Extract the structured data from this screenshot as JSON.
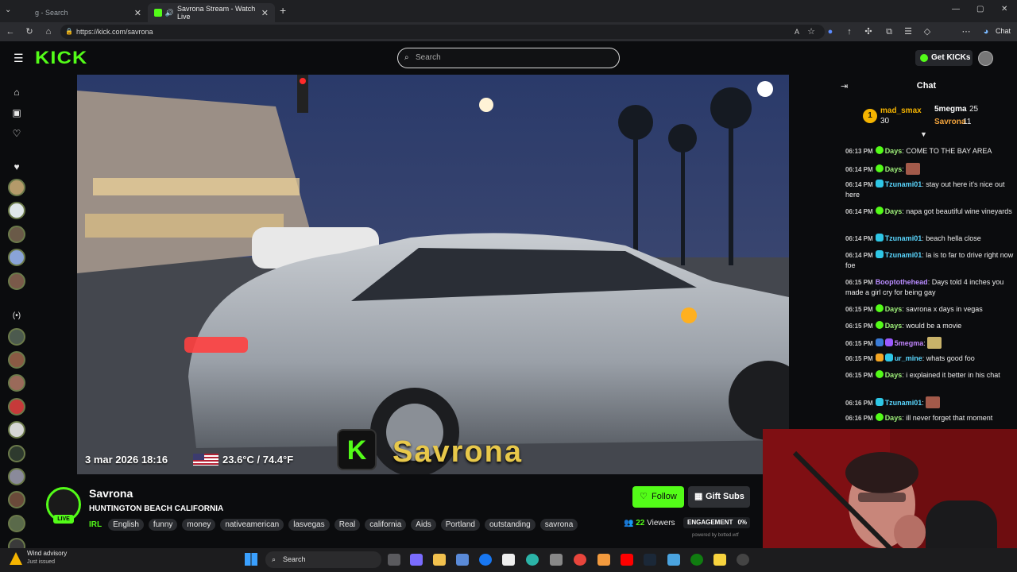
{
  "browser": {
    "tabs": [
      {
        "label": "g - Search",
        "active": false
      },
      {
        "label": "Savrona Stream - Watch Live",
        "active": true
      }
    ],
    "new_tab": "+",
    "url": "https://kick.com/savrona",
    "copilot_label": "Chat"
  },
  "header": {
    "logo": "KICK",
    "search_placeholder": "Search",
    "get_kicks": "Get KICKs"
  },
  "video": {
    "overlay_date": "3 mar 2026 18:16",
    "overlay_temp": "23.6°C / 74.4°F",
    "overlay_name": "Savrona",
    "overlay_logo": "K"
  },
  "channel": {
    "name": "Savrona",
    "live_label": "LIVE",
    "title": "HUNTINGTON BEACH CALIFORNIA",
    "category": "IRL",
    "tags": [
      "English",
      "funny",
      "money",
      "nativeamerican",
      "lasvegas",
      "Real",
      "california",
      "Aids",
      "Portland",
      "outstanding",
      "savrona"
    ],
    "follow": "Follow",
    "gift_subs": "Gift Subs",
    "viewers_count": "22",
    "viewers_label": "Viewers",
    "engagement_label": "ENGAGEMENT",
    "engagement_value": "0%",
    "powered_by": "powered by botted.wtf"
  },
  "chat": {
    "title": "Chat",
    "leaderboard": [
      {
        "rank": "1",
        "name": "mad_smax",
        "count": "30"
      },
      {
        "name": "5megma",
        "count": "25"
      },
      {
        "name": "Savrona",
        "count": "11"
      }
    ],
    "messages": [
      {
        "time": "06:13 PM",
        "user": "Days",
        "text": "COME TO THE BAY AREA"
      },
      {
        "time": "06:14 PM",
        "user": "Days",
        "text": ""
      },
      {
        "time": "06:14 PM",
        "user": "Tzunami01",
        "text": "stay out here it's nice out here"
      },
      {
        "time": "06:14 PM",
        "user": "Days",
        "text": "napa got beautiful wine vineyards"
      },
      {
        "time": "06:14 PM",
        "user": "Tzunami01",
        "text": "beach hella close"
      },
      {
        "time": "06:14 PM",
        "user": "Tzunami01",
        "text": "la is to far to drive right now foe"
      },
      {
        "time": "06:15 PM",
        "user": "Booptothehead",
        "text": "Days told 4 inches you made a girl cry for being gay"
      },
      {
        "time": "06:15 PM",
        "user": "Days",
        "text": "savrona x days in vegas"
      },
      {
        "time": "06:15 PM",
        "user": "Days",
        "text": "would be a movie"
      },
      {
        "time": "06:15 PM",
        "user": "5megma",
        "text": ""
      },
      {
        "time": "06:15 PM",
        "user": "ur_mine",
        "text": "whats good foo"
      },
      {
        "time": "06:15 PM",
        "user": "Days",
        "text": "i explained it better in his chat"
      },
      {
        "time": "06:16 PM",
        "user": "Tzunami01",
        "text": ""
      },
      {
        "time": "06:16 PM",
        "user": "Days",
        "text": "ill never forget that moment"
      }
    ],
    "colors": {
      "days": "#9ff07a",
      "tzunami": "#5ad7ff",
      "boop": "#b98cff",
      "megma": "#c084fc",
      "urmine": "#5ad7ff",
      "accent": "#53fc18"
    }
  },
  "taskbar": {
    "weather_title": "Wind advisory",
    "weather_sub": "Just issued",
    "search": "Search"
  }
}
